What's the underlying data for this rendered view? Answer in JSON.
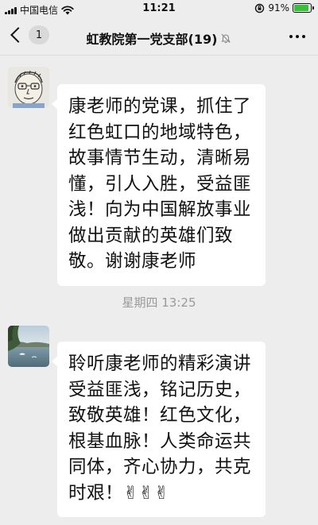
{
  "status_bar": {
    "carrier": "中国电信",
    "time": "11:21",
    "battery_percent": "91%",
    "battery_level": 0.91,
    "battery_color": "#3bbf3b"
  },
  "nav": {
    "unread_count": "1",
    "title": "虹教院第一党支部(19)",
    "back_icon": "chevron-left-icon",
    "mute_icon": "bell-off-icon",
    "more_icon": "more-dots-icon"
  },
  "messages": [
    {
      "avatar": "sketch-face-avatar",
      "lines": [
        "康老师的党课，抓住了",
        "红色虹口的地域特色，",
        "故事情节生动，清晰易",
        "懂，引人入胜，受益匪",
        "浅！向为中国解放事业",
        "做出贡献的英雄们致",
        "敬。谢谢康老师"
      ]
    },
    {
      "avatar": "lake-photo-avatar",
      "lines": [
        "聆听康老师的精彩演讲",
        "受益匪浅，铭记历史，",
        "致敬英雄！红色文化，",
        "根基血脉！人类命运共",
        "同体，齐心协力，共克",
        "时艰！✌✌✌"
      ]
    }
  ],
  "timestamp": "星期四 13:25",
  "colors": {
    "background": "#ededed",
    "bubble": "#ffffff",
    "timestamp_text": "#9a9a9a"
  }
}
